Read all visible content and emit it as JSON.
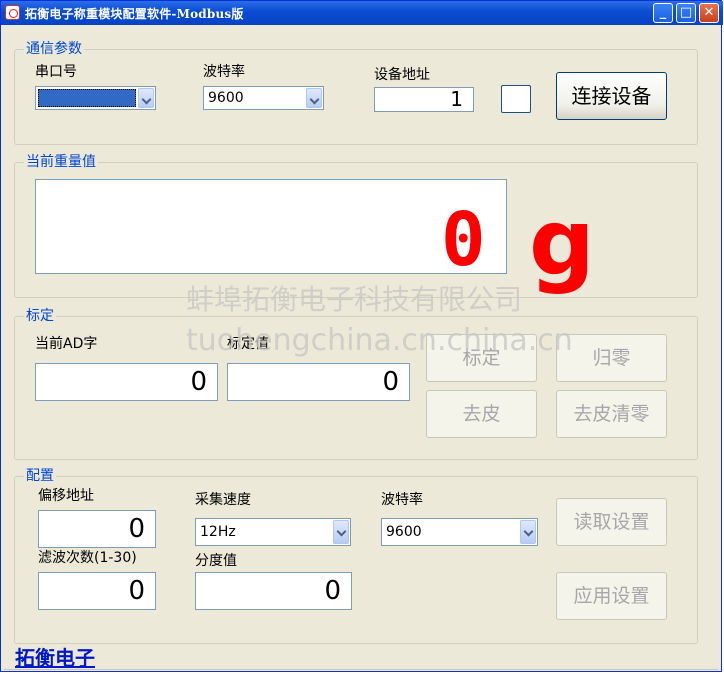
{
  "window": {
    "title": "拓衡电子称重模块配置软件-Modbus版",
    "minimize_symbol": "_",
    "maximize_symbol": "□",
    "close_symbol": "✕"
  },
  "comm": {
    "group_title": "通信参数",
    "port_label": "串口号",
    "port_value": "",
    "baud_label": "波特率",
    "baud_value": "9600",
    "address_label": "设备地址",
    "address_value": "1",
    "connect_button": "连接设备"
  },
  "weight": {
    "group_title": "当前重量值",
    "value": "0",
    "unit": "g"
  },
  "calibration": {
    "group_title": "标定",
    "ad_label": "当前AD字",
    "ad_value": "0",
    "calib_label": "标定值",
    "calib_value": "0",
    "calibrate_button": "标定",
    "zero_button": "归零",
    "tare_button": "去皮",
    "tare_clear_button": "去皮清零"
  },
  "config": {
    "group_title": "配置",
    "offset_label": "偏移地址",
    "offset_value": "0",
    "speed_label": "采集速度",
    "speed_value": "12Hz",
    "baud_label": "波特率",
    "baud_value": "9600",
    "filter_label": "滤波次数(1-30)",
    "filter_value": "0",
    "division_label": "分度值",
    "division_value": "0",
    "read_button": "读取设置",
    "apply_button": "应用设置"
  },
  "watermark": {
    "line1": "蚌埠拓衡电子科技有限公司",
    "line2": "tuohengchina.cn.china.cn"
  },
  "footer": {
    "link_text": "拓衡电子"
  },
  "colors": {
    "title_bar": "#0a4cd1",
    "group_title": "#0046d5",
    "weight_display": "#ff0000",
    "footer_link": "#0018c7"
  }
}
